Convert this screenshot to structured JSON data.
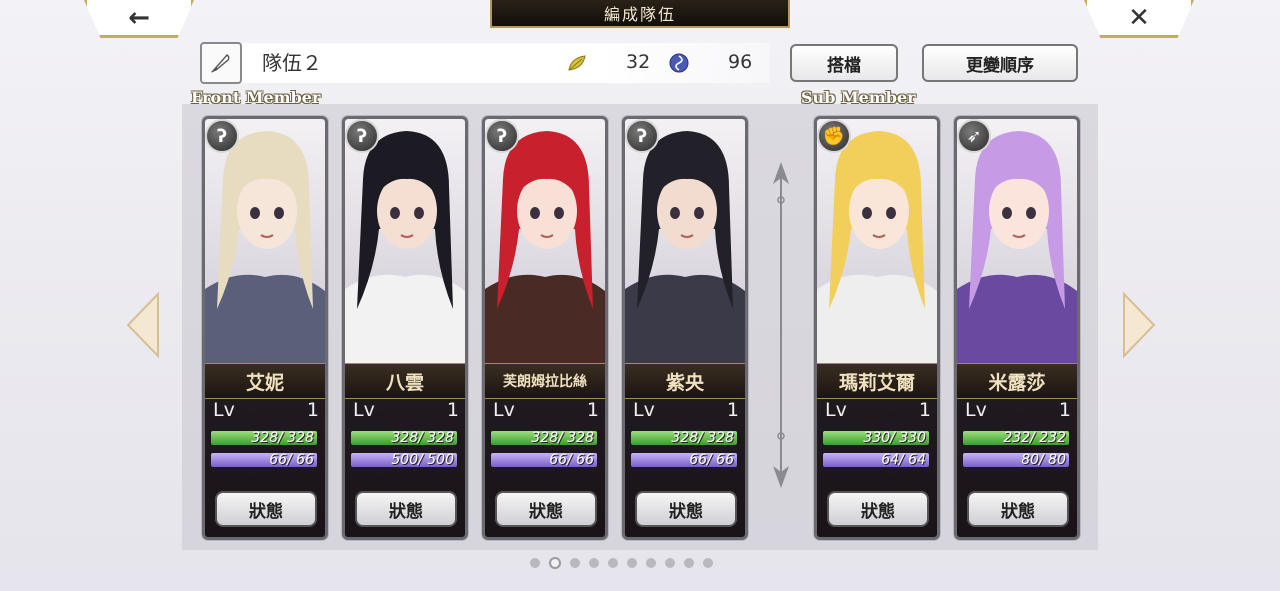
{
  "header": {
    "title": "編成隊伍",
    "back_icon": "←",
    "close_icon": "✕"
  },
  "team": {
    "name": "隊伍２",
    "leaf_value": "32",
    "swirl_value": "96"
  },
  "buttons": {
    "partner": "搭檔",
    "reorder": "更變順序"
  },
  "sections": {
    "front": "Front Member",
    "sub": "Sub Member"
  },
  "colors": {
    "hp_bar": "#4caf3a",
    "mp_bar": "#8c72d8",
    "frame_gold": "#c9a85a"
  },
  "front_members": [
    {
      "name": "艾妮",
      "type_icon": "hook-icon",
      "type_glyph": "ʔ",
      "lv_label": "Lv",
      "lv": "1",
      "hp": "328/  328",
      "mp": "66/   66",
      "status": "狀態",
      "hair": "#e8dcc0",
      "skin": "#f6e6da",
      "outfit": "#5a5f7a"
    },
    {
      "name": "八雲",
      "type_icon": "hook-icon",
      "type_glyph": "ʔ",
      "lv_label": "Lv",
      "lv": "1",
      "hp": "328/  328",
      "mp": "500/  500",
      "status": "狀態",
      "hair": "#1c1a22",
      "skin": "#f4dfd2",
      "outfit": "#f2f2f2"
    },
    {
      "name": "芙朗姆拉比絲",
      "type_icon": "hook-icon",
      "type_glyph": "ʔ",
      "lv_label": "Lv",
      "lv": "1",
      "hp": "328/  328",
      "mp": "66/   66",
      "status": "狀態",
      "hair": "#c8202c",
      "skin": "#f8e0d6",
      "outfit": "#4a2a24"
    },
    {
      "name": "紫央",
      "type_icon": "hook-icon",
      "type_glyph": "ʔ",
      "lv_label": "Lv",
      "lv": "1",
      "hp": "328/  328",
      "mp": "66/   66",
      "status": "狀態",
      "hair": "#222028",
      "skin": "#f2dccf",
      "outfit": "#3a3a48"
    }
  ],
  "sub_members": [
    {
      "name": "瑪莉艾爾",
      "type_icon": "fist-icon",
      "type_glyph": "✊",
      "lv_label": "Lv",
      "lv": "1",
      "hp": "330/  330",
      "mp": "64/   64",
      "status": "狀態",
      "hair": "#f2cf5a",
      "skin": "#fae6d8",
      "outfit": "#eeeeee"
    },
    {
      "name": "米露莎",
      "type_icon": "arrow-icon",
      "type_glyph": "➶",
      "lv_label": "Lv",
      "lv": "1",
      "hp": "232/  232",
      "mp": "80/   80",
      "status": "狀態",
      "hair": "#c79ae6",
      "skin": "#fae4dc",
      "outfit": "#6a4aa0"
    }
  ],
  "pagination": {
    "total": 10,
    "active": 1
  }
}
